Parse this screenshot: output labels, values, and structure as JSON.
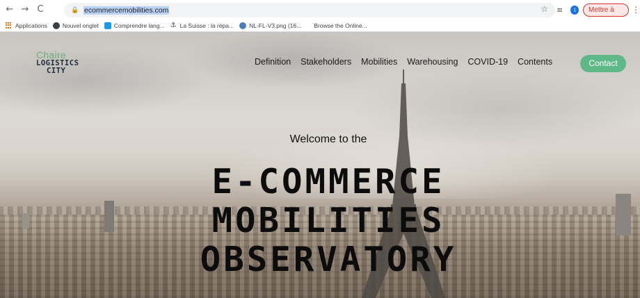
{
  "browser": {
    "nav": {
      "back": "←",
      "forward": "→",
      "reload": "C"
    },
    "url": "ecommercemobilities.com",
    "update_button": "Mettre à jour",
    "profile_initial": "I"
  },
  "bookmarks": [
    {
      "label": "Applications",
      "icon": "apps-grid-icon"
    },
    {
      "label": "Nouvel onglet",
      "icon": "chrome-icon"
    },
    {
      "label": "Comprendre lang...",
      "icon": "bookmark-favicon"
    },
    {
      "label": "La Suisse : la répa...",
      "icon": "anchor-icon"
    },
    {
      "label": "NL-FL-V3.png (16...",
      "icon": "image-favicon"
    },
    {
      "label": "Browse the Online...",
      "icon": ""
    }
  ],
  "site": {
    "logo": {
      "line1": "Chaire",
      "line2": "LOGISTICS",
      "line3": "CITY"
    },
    "nav": [
      "Definition",
      "Stakeholders",
      "Mobilities",
      "Warehousing",
      "COVID-19",
      "Contents"
    ],
    "contact": "Contact",
    "welcome": "Welcome to the",
    "title_lines": [
      "E-COMMERCE",
      "MOBILITIES",
      "OBSERVATORY"
    ]
  },
  "colors": {
    "contact_bg": "#5fb888",
    "logo_green": "#6fb07a",
    "logo_dark": "#1c2b3a",
    "update_red": "#d93025"
  }
}
